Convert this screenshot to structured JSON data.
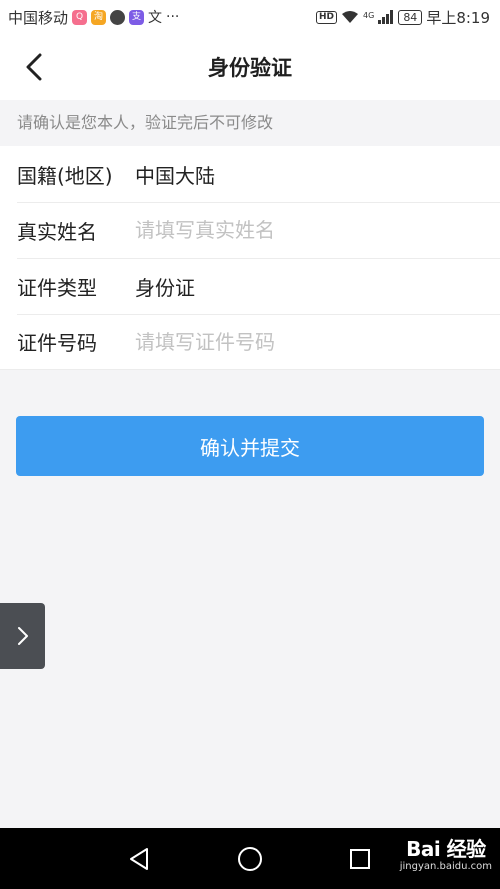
{
  "status_bar": {
    "carrier": "中国移动",
    "overflow": "···",
    "network": "HD",
    "signal_label": "4G",
    "battery": "84",
    "time": "早上8:19",
    "app_icons": [
      "qq-icon",
      "taobao-icon",
      "wechat-icon",
      "alipay-icon",
      "text-icon"
    ]
  },
  "header": {
    "title": "身份验证",
    "back_icon": "chevron-left-icon"
  },
  "notice": "请确认是您本人，验证完后不可修改",
  "form": {
    "nationality_label": "国籍(地区)",
    "nationality_value": "中国大陆",
    "name_label": "真实姓名",
    "name_placeholder": "请填写真实姓名",
    "id_type_label": "证件类型",
    "id_type_value": "身份证",
    "id_number_label": "证件号码",
    "id_number_placeholder": "请填写证件号码"
  },
  "submit_label": "确认并提交",
  "side_tab_icon": "chevron-right-icon",
  "nav_bar": {
    "back_icon": "triangle-back-icon",
    "home_icon": "circle-home-icon",
    "recents_icon": "square-recents-icon"
  },
  "watermark": {
    "brand": "Bai 经验",
    "url": "jingyan.baidu.com"
  },
  "colors": {
    "accent": "#3d9cf0",
    "background": "#f4f4f6",
    "placeholder": "#c2c2c2",
    "notice_text": "#8a8a8a"
  }
}
